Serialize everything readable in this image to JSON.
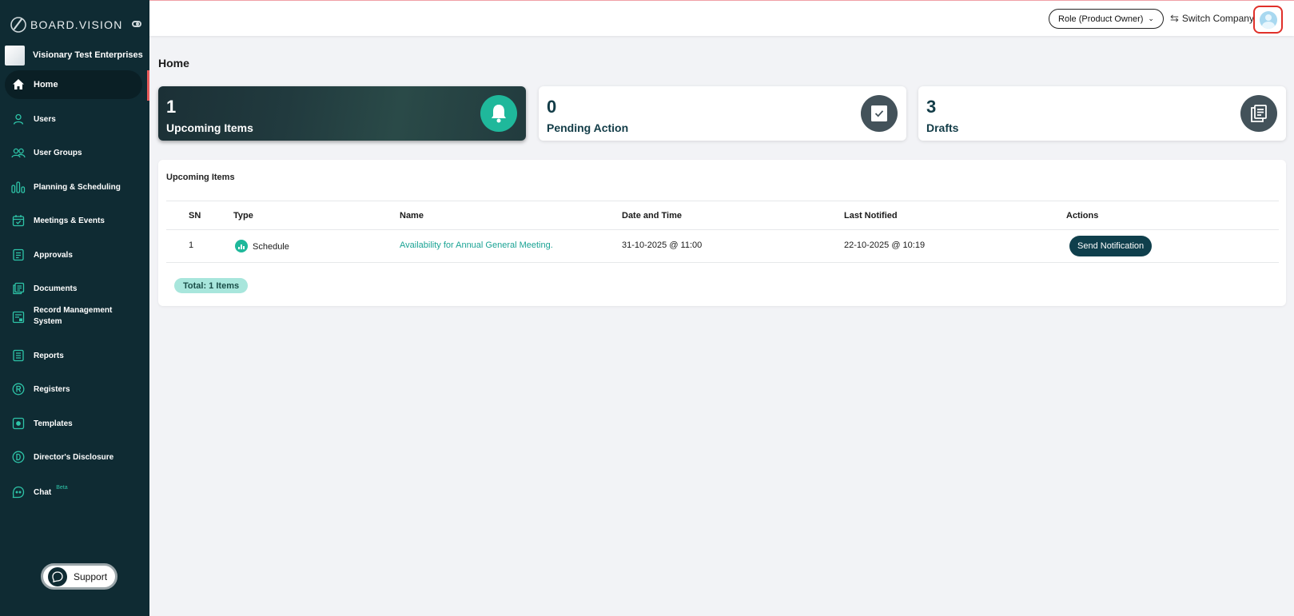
{
  "brand": {
    "name": "BOARD.VISION"
  },
  "company": {
    "name": "Visionary Test Enterprises"
  },
  "sidebar": {
    "items": [
      {
        "label": "Home",
        "icon": "home-icon",
        "active": true
      },
      {
        "label": "Users",
        "icon": "user-icon"
      },
      {
        "label": "User Groups",
        "icon": "user-group-icon"
      },
      {
        "label": "Planning & Scheduling",
        "icon": "planning-icon"
      },
      {
        "label": "Meetings & Events",
        "icon": "calendar-icon"
      },
      {
        "label": "Approvals",
        "icon": "approval-icon"
      },
      {
        "label": "Documents",
        "icon": "documents-icon"
      },
      {
        "label": "Record Management System",
        "icon": "record-icon"
      },
      {
        "label": "Reports",
        "icon": "reports-icon"
      },
      {
        "label": "Registers",
        "icon": "registers-icon"
      },
      {
        "label": "Templates",
        "icon": "templates-icon"
      },
      {
        "label": "Director's Disclosure",
        "icon": "disclosure-icon"
      },
      {
        "label": "Chat",
        "icon": "chat-icon",
        "badge": "Beta"
      }
    ],
    "support_label": "Support"
  },
  "topbar": {
    "role_label": "Role (Product Owner)",
    "switch_company_label": "Switch Company"
  },
  "page": {
    "title": "Home"
  },
  "cards": [
    {
      "count": "1",
      "label": "Upcoming Items",
      "icon": "bell-icon"
    },
    {
      "count": "0",
      "label": "Pending Action",
      "icon": "checkbox-icon"
    },
    {
      "count": "3",
      "label": "Drafts",
      "icon": "drafts-icon"
    }
  ],
  "panel": {
    "title": "Upcoming Items",
    "columns": [
      "SN",
      "Type",
      "Name",
      "Date and Time",
      "Last Notified",
      "Actions"
    ],
    "rows": [
      {
        "sn": "1",
        "type": "Schedule",
        "name": "Availability for Annual General Meeting.",
        "datetime": "31-10-2025 @ 11:00",
        "last_notified": "22-10-2025 @ 10:19",
        "action": "Send Notification"
      }
    ],
    "total": "Total: 1 Items"
  },
  "colors": {
    "sidebar_bg": "#0f2b33",
    "accent_teal": "#1fb89b",
    "link_teal": "#1aa394",
    "button_dark": "#0f3f4c",
    "active_marker": "#e65a5a"
  }
}
